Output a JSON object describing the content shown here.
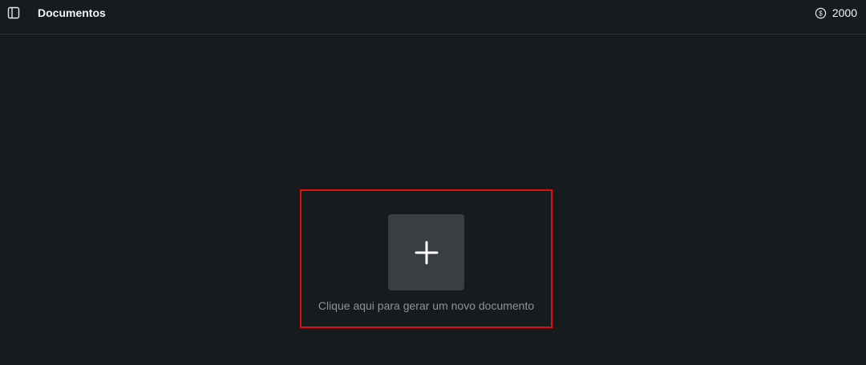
{
  "header": {
    "title": "Documentos",
    "sidebar_toggle_icon": "sidebar-toggle-icon",
    "credits": {
      "icon": "dollar-coin-icon",
      "value": "2000"
    }
  },
  "main": {
    "new_document": {
      "icon": "plus-icon",
      "label": "Clique aqui para gerar um novo documento"
    },
    "highlight_color": "#e00d12"
  },
  "colors": {
    "background": "#181b1e",
    "button_background": "#3a3d41",
    "text_primary": "#f2f3f4",
    "text_muted": "#8e9297"
  }
}
